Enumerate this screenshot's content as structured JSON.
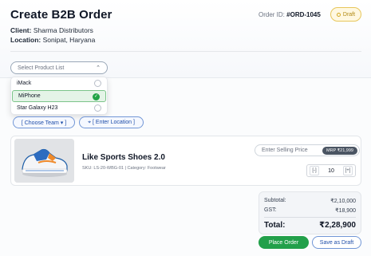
{
  "header": {
    "title": "Create B2B Order",
    "client_label": "Client:",
    "client_value": "Sharma Distributors",
    "location_label": "Location:",
    "location_value": "Sonipat, Haryana",
    "order_id_label": "Order ID:",
    "order_id_value": "#ORD-1045",
    "status_badge": "Draft"
  },
  "product_list": {
    "placeholder": "Select Product List",
    "options": [
      {
        "label": "iMack",
        "selected": false
      },
      {
        "label": "MiPhone",
        "selected": true
      },
      {
        "label": "Star Galaxy H23",
        "selected": false
      }
    ]
  },
  "chips": {
    "team": "[ Choose Team ▾ ]",
    "location": "[ Enter Location ]"
  },
  "product": {
    "name": "Like Sports Shoes 2.0",
    "sku_line": "SKU: LS-20-WBG-01 | Category: Footwear",
    "price_placeholder": "Enter Selling Price",
    "mrp": "MRP ₹21,999",
    "qty_minus": "[-]",
    "qty_value": "10",
    "qty_plus": "[+]"
  },
  "summary": {
    "subtotal_label": "Subtotal:",
    "subtotal_value": "₹2,10,000",
    "gst_label": "GST:",
    "gst_value": "₹18,900",
    "total_label": "Total:",
    "total_value": "₹2,28,900"
  },
  "actions": {
    "place_order": "Place Order",
    "save_draft": "Save as Draft"
  },
  "colors": {
    "accent_green": "#22a04a",
    "accent_blue": "#1f4ea8",
    "draft_yellow": "#e7c65a"
  }
}
